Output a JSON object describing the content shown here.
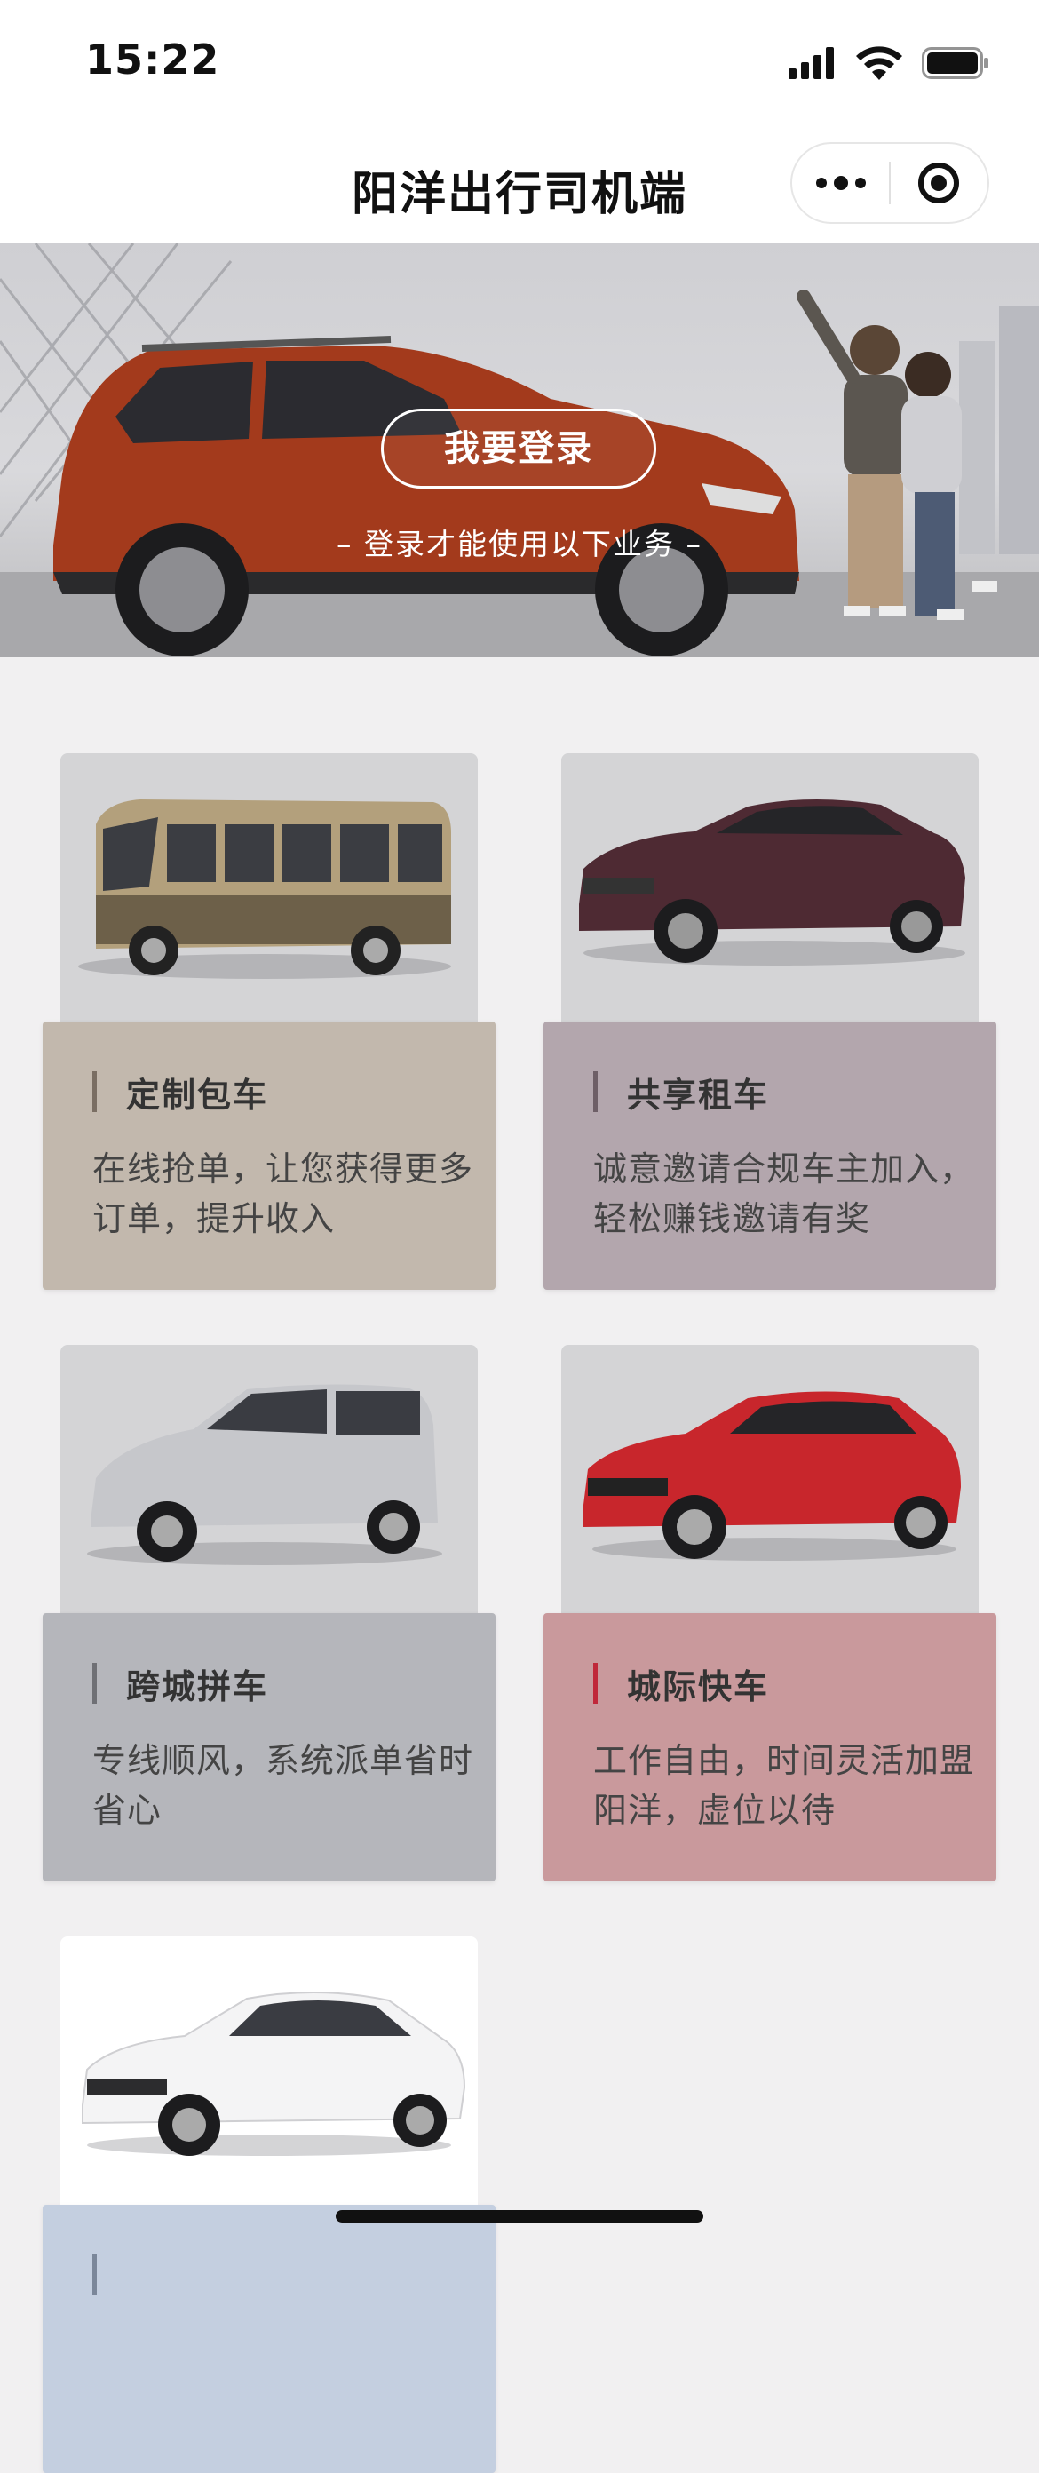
{
  "status_bar": {
    "time": "15:22"
  },
  "nav": {
    "title": "阳洋出行司机端"
  },
  "banner": {
    "login_label": "我要登录",
    "hint": "– 登录才能使用以下业务 –"
  },
  "services": [
    {
      "title": "定制包车",
      "desc": "在线抢单，让您获得更多订单，提升收入",
      "panel_color": "#c2b8ad",
      "bar_color": "#7a6e63",
      "vehicle": "minibus"
    },
    {
      "title": "共享租车",
      "desc": "诚意邀请合规车主加入，轻松赚钱邀请有奖",
      "panel_color": "#b3a6ad",
      "bar_color": "#6e5f67",
      "vehicle": "sedan"
    },
    {
      "title": "跨城拼车",
      "desc": "专线顺风，系统派单省时省心",
      "panel_color": "#b5b6bb",
      "bar_color": "#6f7075",
      "vehicle": "van"
    },
    {
      "title": "城际快车",
      "desc": "工作自由，时间灵活加盟阳洋，虚位以待",
      "panel_color": "#c9999c",
      "bar_color": "#c0283a",
      "vehicle": "hatchback"
    },
    {
      "title": "",
      "desc": "",
      "panel_color": "#c4cfe0",
      "bar_color": "#7b879a",
      "vehicle": "white-sedan"
    }
  ]
}
